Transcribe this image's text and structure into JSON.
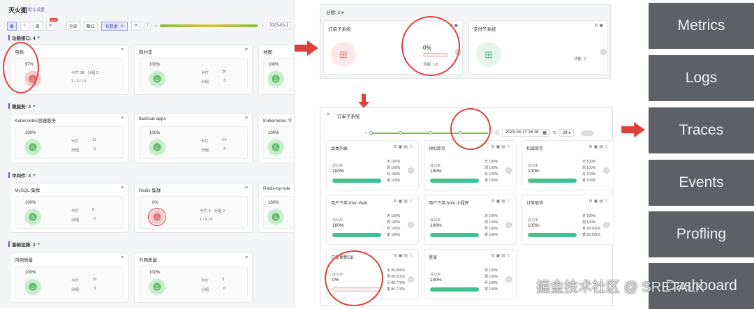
{
  "left": {
    "title": "灭火图",
    "subtitle": "默认设置",
    "toolbar": {
      "scope_all": "全部",
      "scope_red": "飘红",
      "scope_data": "有数据",
      "scope_arrow": "∨",
      "date": "2023-03-1",
      "badge": "new"
    },
    "sections": [
      {
        "label": "功能接口: 4"
      },
      {
        "label": "微服务: 3"
      },
      {
        "label": "中间件: 4"
      },
      {
        "label": "基础设施: 2"
      }
    ],
    "cards": {
      "ecommerce": {
        "title": "电商",
        "pct": "97%",
        "stats_line1": "卡片 38 · 分组 2",
        "stats_line2": "1 / 37 / 0"
      },
      "carhail": {
        "title": "网约车",
        "pct": "100%",
        "k1": "卡片",
        "v1": "20",
        "k2": "分组",
        "v2": "3"
      },
      "map": {
        "title": "地图",
        "pct": "100%"
      },
      "k8s": {
        "title": "Kubernetes容器服务",
        "pct": "100%",
        "k1": "卡片",
        "v1": "11",
        "k2": "分组",
        "v2": "6"
      },
      "flashcat": {
        "title": "flashcat-apps",
        "pct": "100%",
        "k1": "卡片",
        "v1": "14",
        "k2": "分组",
        "v2": "4"
      },
      "k8s2": {
        "title": "Kubernetes 平",
        "pct": "100%"
      },
      "mysql": {
        "title": "MySQL 集群",
        "pct": "100%",
        "k1": "卡片",
        "v1": "5",
        "k2": "分组",
        "v2": "2"
      },
      "redis": {
        "title": "Redis 集群",
        "pct": "0%",
        "stats_line1": "卡片 5 · 分组 2",
        "stats_line2": "1 / 4 / 0"
      },
      "redisrule": {
        "title": "Redis-by-rule",
        "pct": "100%"
      },
      "intranet": {
        "title": "内网质量",
        "pct": "100%",
        "k1": "卡片",
        "v1": "19",
        "k2": "分组",
        "v2": "3"
      },
      "extranet": {
        "title": "外网质量",
        "pct": "100%",
        "k1": "卡片",
        "v1": "3",
        "k2": "分组",
        "v2": "0"
      }
    }
  },
  "topmid": {
    "group_label": "分组: 2",
    "order": {
      "title": "订单子系统",
      "pct": "0%",
      "func_label": "功能:",
      "func_value": "1/8"
    },
    "pay": {
      "title": "支付子系统",
      "func_label": "功能:",
      "func_value": "2"
    }
  },
  "botmid": {
    "title": "订单子系统",
    "date": "2023-04-17 16:26",
    "refresh": "off",
    "success_label": "成功率",
    "cards": [
      {
        "title": "品类列表",
        "value": "100%",
        "stats": [
          "天 100%",
          "周 100%",
          "月 100%",
          "季 100%"
        ]
      },
      {
        "title": "预扣库存",
        "value": "100%",
        "stats": [
          "天 100%",
          "周 100%",
          "月 100%",
          "季 100%"
        ]
      },
      {
        "title": "扣减库存",
        "value": "100%",
        "stats": [
          "天 100%",
          "周 100%",
          "月 100%",
          "季 100%"
        ]
      },
      {
        "title": "用户下单-from Web",
        "value": "100%",
        "stats": [
          "天 100%",
          "周 100%",
          "月 100%",
          "季 100%"
        ]
      },
      {
        "title": "用户下单-from 小程序",
        "value": "100%",
        "stats": [
          "天 100%",
          "周 100%",
          "月 100%",
          "季 100%"
        ]
      },
      {
        "title": "订单取消",
        "value": "100%",
        "stats": [
          "天 100%",
          "周 100%",
          "月 99.991%",
          "季 99.991%"
        ]
      },
      {
        "title": "订单更新DB",
        "value": "0%",
        "stats": [
          "天 85.996%",
          "周 86.511%",
          "月 86.779%",
          "季 86.779%"
        ]
      },
      {
        "title": "登录",
        "value": "100%",
        "stats": [
          "天 100%",
          "周 100%",
          "月 100%",
          "季 100%"
        ]
      }
    ]
  },
  "right": {
    "items": [
      "Metrics",
      "Logs",
      "Traces",
      "Events",
      "Profling",
      "Dashboard"
    ]
  },
  "watermark": "掘金技术社区 @ SRETALK",
  "colors": {
    "red": "#e0403c",
    "accent": "#5560d8",
    "green": "#4cbf86",
    "dark_box": "#5d6166"
  }
}
